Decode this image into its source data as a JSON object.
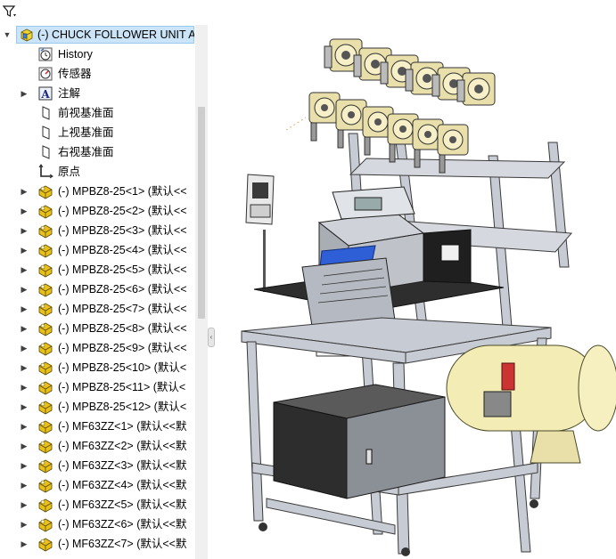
{
  "feature_tree": {
    "root": {
      "label": "(-) CHUCK FOLLOWER UNIT A",
      "icon": "assembly-icon"
    },
    "items": [
      {
        "label": "History",
        "icon": "history-icon",
        "expandable": false,
        "indent": 1
      },
      {
        "label": "传感器",
        "icon": "sensor-icon",
        "expandable": false,
        "indent": 1
      },
      {
        "label": "注解",
        "icon": "annotation-icon",
        "expandable": true,
        "indent": 1
      },
      {
        "label": "前视基准面",
        "icon": "plane-icon",
        "expandable": false,
        "indent": 1
      },
      {
        "label": "上视基准面",
        "icon": "plane-icon",
        "expandable": false,
        "indent": 1
      },
      {
        "label": "右视基准面",
        "icon": "plane-icon",
        "expandable": false,
        "indent": 1
      },
      {
        "label": "原点",
        "icon": "origin-icon",
        "expandable": false,
        "indent": 1
      },
      {
        "label": "(-) MPBZ8-25<1> (默认<<",
        "icon": "part-icon",
        "expandable": true,
        "indent": 1
      },
      {
        "label": "(-) MPBZ8-25<2> (默认<<",
        "icon": "part-icon",
        "expandable": true,
        "indent": 1
      },
      {
        "label": "(-) MPBZ8-25<3> (默认<<",
        "icon": "part-icon",
        "expandable": true,
        "indent": 1
      },
      {
        "label": "(-) MPBZ8-25<4> (默认<<",
        "icon": "part-icon",
        "expandable": true,
        "indent": 1
      },
      {
        "label": "(-) MPBZ8-25<5> (默认<<",
        "icon": "part-icon",
        "expandable": true,
        "indent": 1
      },
      {
        "label": "(-) MPBZ8-25<6> (默认<<",
        "icon": "part-icon",
        "expandable": true,
        "indent": 1
      },
      {
        "label": "(-) MPBZ8-25<7> (默认<<",
        "icon": "part-icon",
        "expandable": true,
        "indent": 1
      },
      {
        "label": "(-) MPBZ8-25<8> (默认<<",
        "icon": "part-icon",
        "expandable": true,
        "indent": 1
      },
      {
        "label": "(-) MPBZ8-25<9> (默认<<",
        "icon": "part-icon",
        "expandable": true,
        "indent": 1
      },
      {
        "label": "(-) MPBZ8-25<10> (默认<",
        "icon": "part-icon",
        "expandable": true,
        "indent": 1
      },
      {
        "label": "(-) MPBZ8-25<11> (默认<",
        "icon": "part-icon",
        "expandable": true,
        "indent": 1
      },
      {
        "label": "(-) MPBZ8-25<12> (默认<",
        "icon": "part-icon",
        "expandable": true,
        "indent": 1
      },
      {
        "label": "(-) MF63ZZ<1> (默认<<默",
        "icon": "part-icon",
        "expandable": true,
        "indent": 1
      },
      {
        "label": "(-) MF63ZZ<2> (默认<<默",
        "icon": "part-icon",
        "expandable": true,
        "indent": 1
      },
      {
        "label": "(-) MF63ZZ<3> (默认<<默",
        "icon": "part-icon",
        "expandable": true,
        "indent": 1
      },
      {
        "label": "(-) MF63ZZ<4> (默认<<默",
        "icon": "part-icon",
        "expandable": true,
        "indent": 1
      },
      {
        "label": "(-) MF63ZZ<5> (默认<<默",
        "icon": "part-icon",
        "expandable": true,
        "indent": 1
      },
      {
        "label": "(-) MF63ZZ<6> (默认<<默",
        "icon": "part-icon",
        "expandable": true,
        "indent": 1
      },
      {
        "label": "(-) MF63ZZ<7> (默认<<默",
        "icon": "part-icon",
        "expandable": true,
        "indent": 1
      }
    ]
  },
  "filter": {
    "icon": "filter-icon"
  },
  "viewport": {
    "description_icon": "assembly-model-view"
  },
  "colors": {
    "selection_bg": "#cce4f7",
    "part_icon": "#e8c01a",
    "frame": "#c7cbd3",
    "accent_blue": "#2e5fd6",
    "tank": "#f3ecb4"
  }
}
